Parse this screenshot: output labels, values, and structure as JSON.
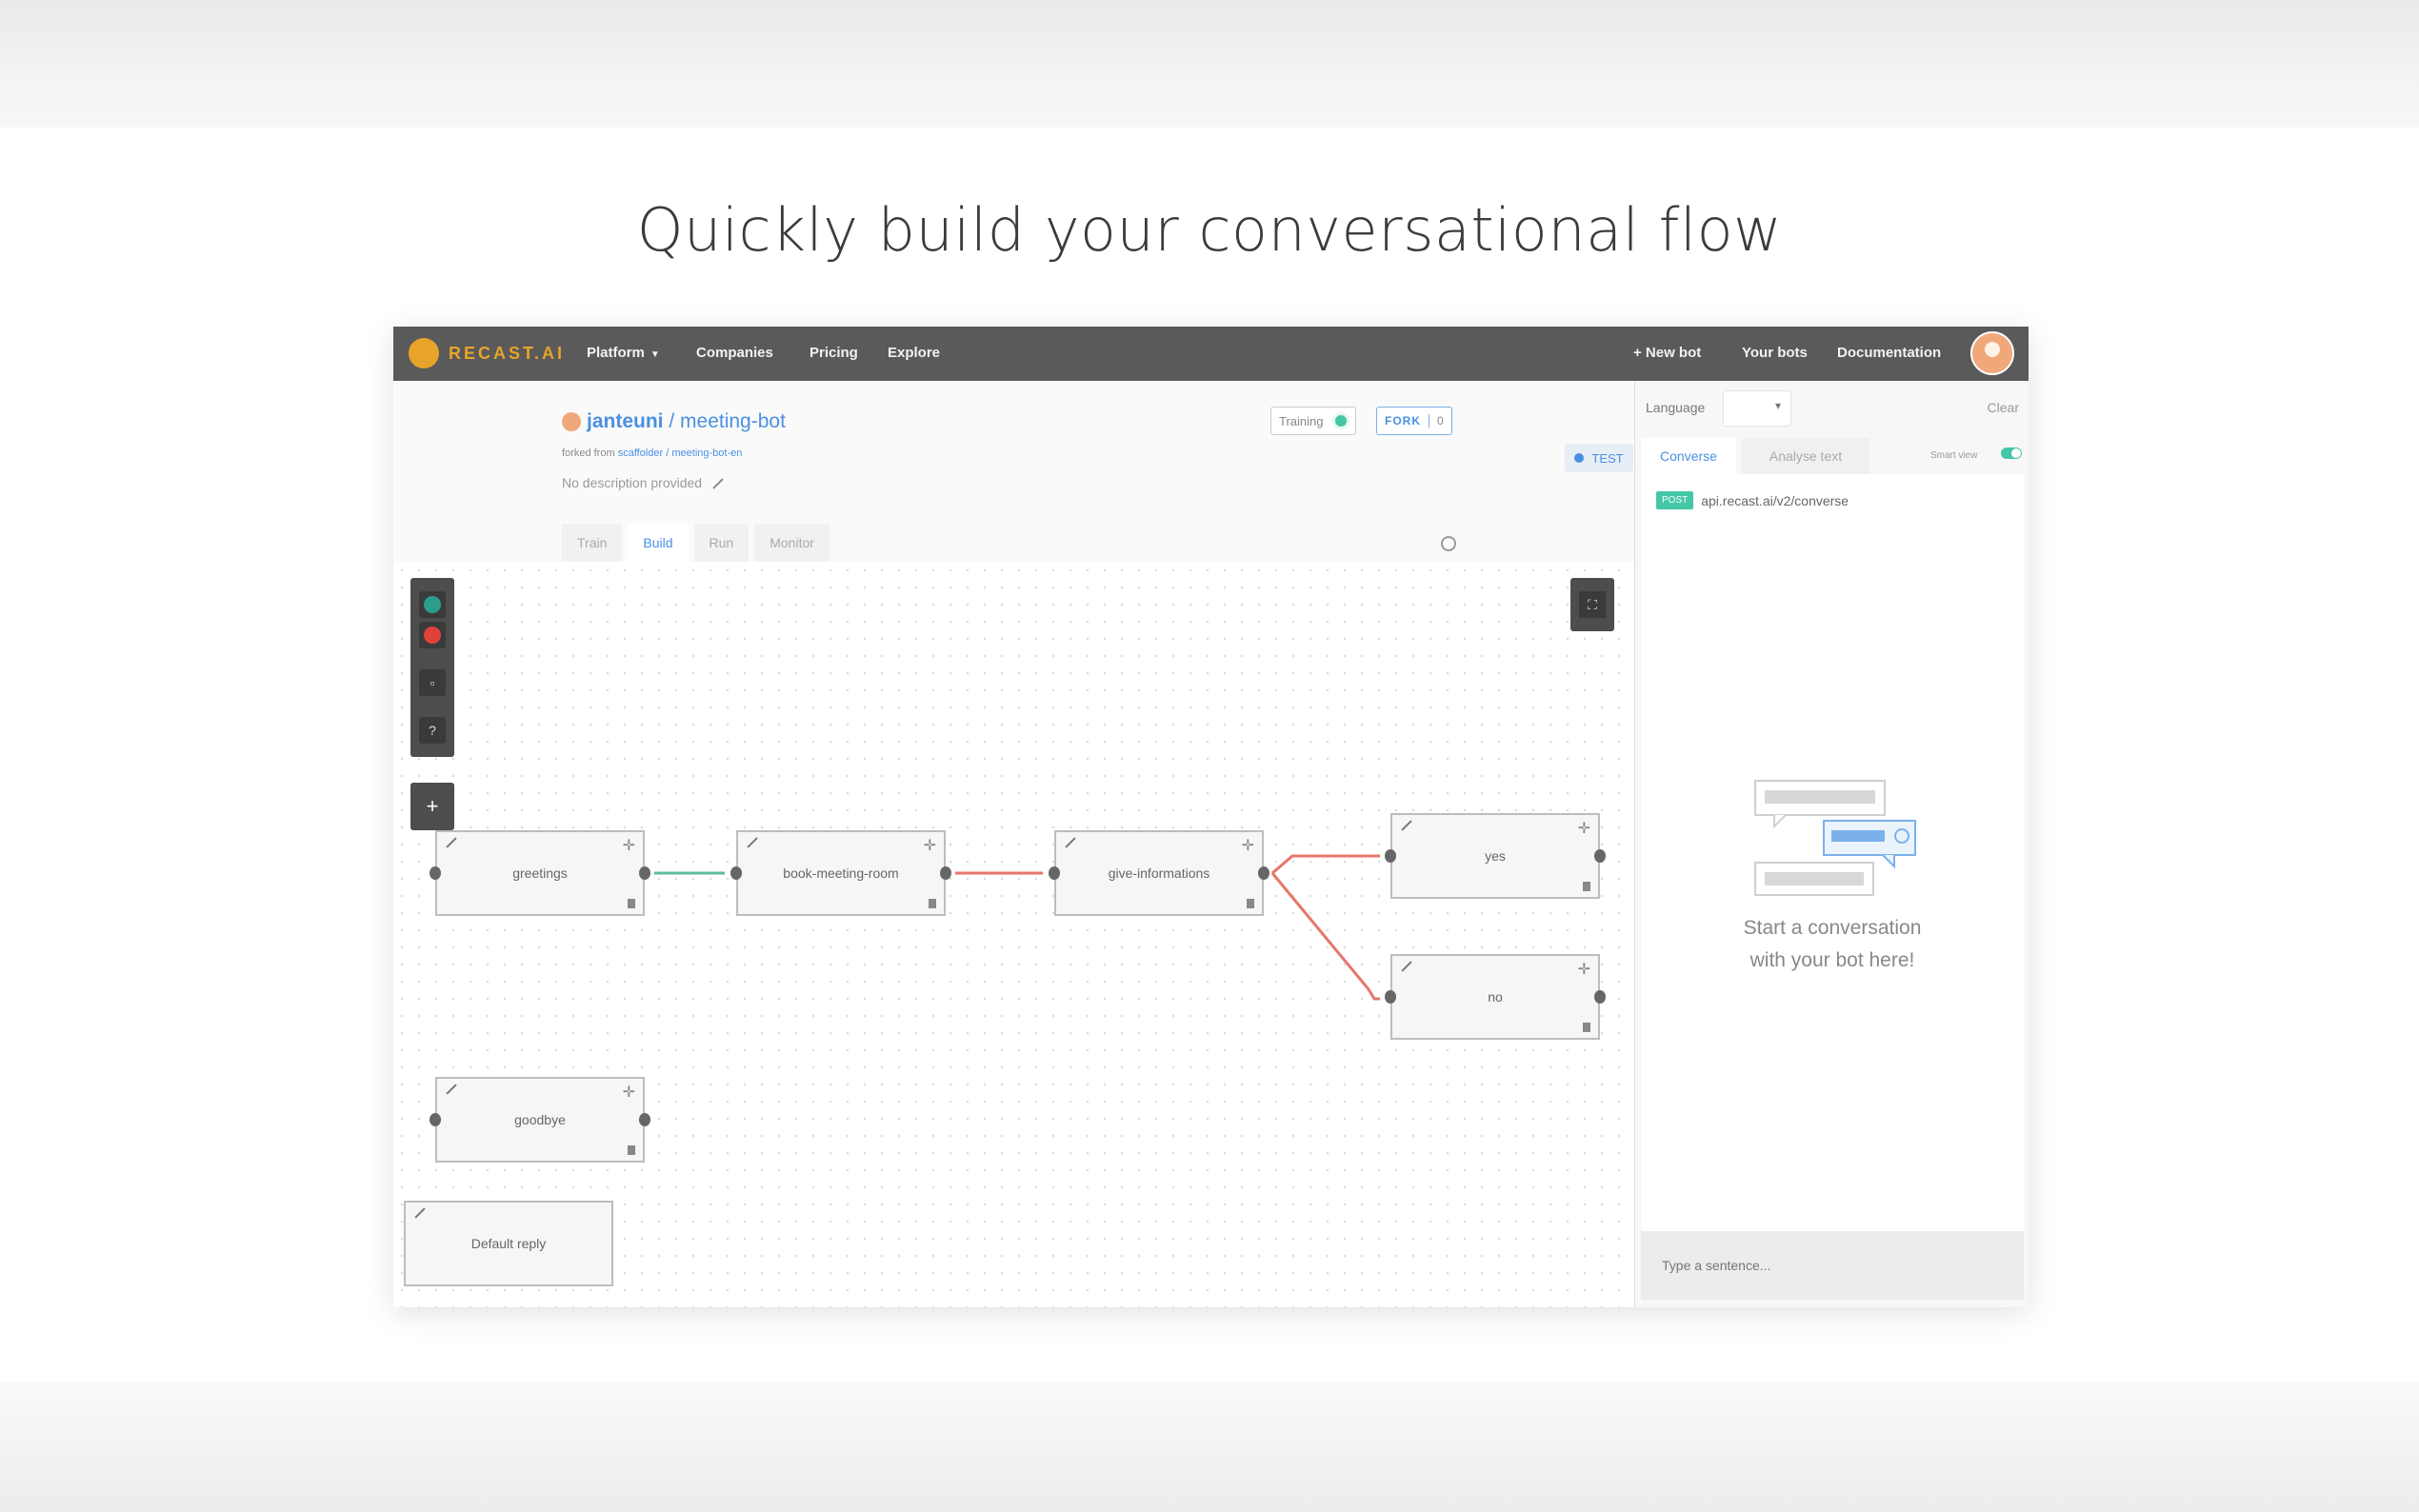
{
  "headline": "Quickly build your conversational flow",
  "nav": {
    "logo_text": "RECAST.AI",
    "items": [
      "Platform",
      "Companies",
      "Pricing",
      "Explore"
    ],
    "right": [
      "+ New bot",
      "Your bots",
      "Documentation"
    ]
  },
  "bot": {
    "owner": "janteuni",
    "separator": " / ",
    "name": "meeting-bot",
    "forked_prefix": "forked from",
    "forked_source": "scaffolder / meeting-bot-en",
    "description": "No description provided",
    "training_label": "Training",
    "fork_label": "FORK",
    "fork_count": "0",
    "test_label": "TEST",
    "tabs": [
      "Train",
      "Build",
      "Run",
      "Monitor"
    ],
    "active_tab": "Build"
  },
  "toolbar": {
    "colors": [
      "#2a9e88",
      "#e0413a"
    ],
    "help": "?",
    "add": "+",
    "fit": "⛶"
  },
  "flow": {
    "nodes": [
      "greetings",
      "book-meeting-room",
      "give-informations",
      "yes",
      "no",
      "goodbye"
    ],
    "default_reply": "Default reply",
    "link_colors": {
      "first": "#5fb9a0",
      "rest": "#e8766b"
    }
  },
  "panel": {
    "language_label": "Language",
    "clear_label": "Clear",
    "tabs": [
      "Converse",
      "Analyse text"
    ],
    "smart_view_label": "Smart view",
    "method": "POST",
    "endpoint": "api.recast.ai/v2/converse",
    "empty_line1": "Start a conversation",
    "empty_line2": "with your bot here!",
    "input_placeholder": "Type a sentence..."
  }
}
